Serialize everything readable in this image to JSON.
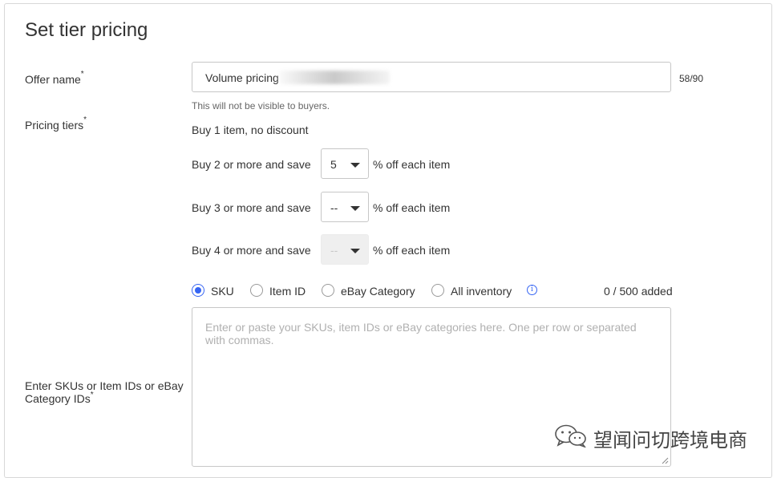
{
  "title": "Set tier pricing",
  "offer_name": {
    "label": "Offer name",
    "required_mark": "*",
    "value": "Volume pricing",
    "counter": "58/90",
    "hint": "This will not be visible to buyers."
  },
  "pricing_tiers": {
    "label": "Pricing tiers",
    "required_mark": "*",
    "base_tier": "Buy 1 item, no discount",
    "suffix": "% off each item",
    "tiers": [
      {
        "label": "Buy 2 or more and save",
        "selected": "5",
        "disabled": false
      },
      {
        "label": "Buy 3 or more and save",
        "selected": "--",
        "disabled": false
      },
      {
        "label": "Buy 4 or more and save",
        "selected": "--",
        "disabled": true
      }
    ]
  },
  "scope": {
    "options": [
      "SKU",
      "Item ID",
      "eBay Category",
      "All inventory"
    ],
    "selected": "SKU",
    "info_icon": "info-icon",
    "added_count": "0 / 500 added"
  },
  "ids_input": {
    "label": "Enter SKUs or Item IDs or eBay Category IDs",
    "required_mark": "*",
    "placeholder": "Enter or paste your SKUs, item IDs or eBay categories here. One per row or separated with commas."
  },
  "watermark": {
    "icon": "wechat-icon",
    "text": "望闻问切跨境电商"
  },
  "colors": {
    "accent": "#3665f3",
    "border": "#c7c7c7",
    "text": "#333333",
    "placeholder": "#b0b0b0"
  }
}
